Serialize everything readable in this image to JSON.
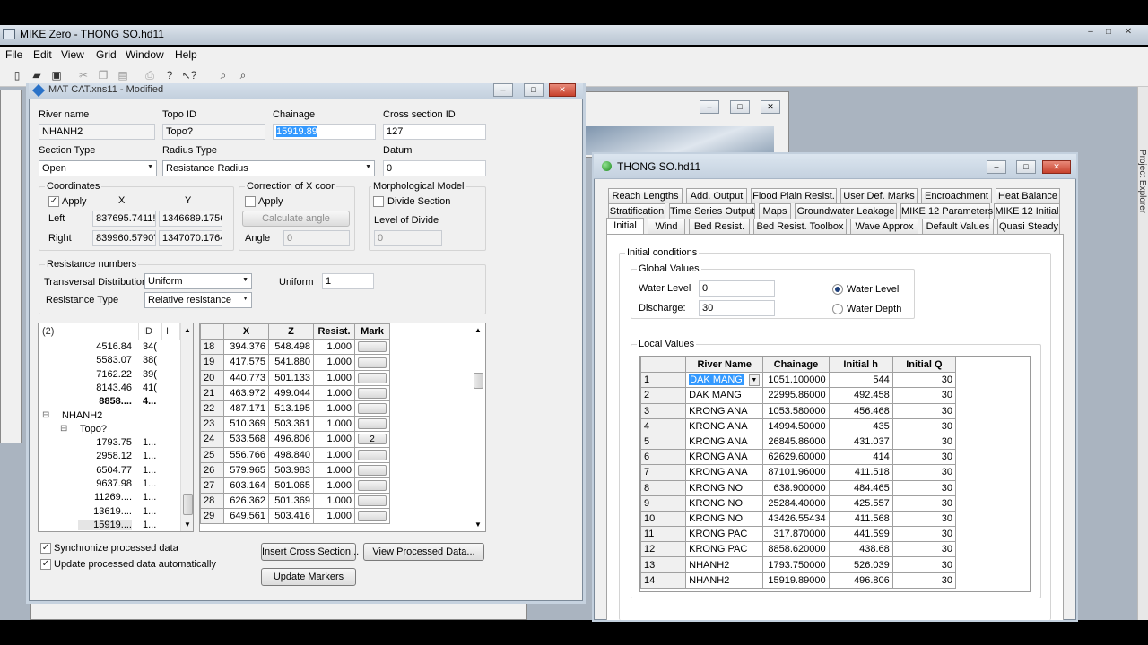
{
  "app": {
    "title": "MIKE Zero - THONG SO.hd11",
    "menu": [
      "File",
      "Edit",
      "View",
      "Grid",
      "Window",
      "Help"
    ]
  },
  "xs_window": {
    "title": "MAT CAT.xns11 - Modified",
    "river_name_label": "River name",
    "river_name": "NHANH2",
    "topo_id_label": "Topo ID",
    "topo_id": "Topo?",
    "chainage_label": "Chainage",
    "chainage": "15919.89",
    "cross_section_id_label": "Cross section ID",
    "cross_section_id": "127",
    "section_type_label": "Section Type",
    "section_type": "Open",
    "radius_type_label": "Radius Type",
    "radius_type": "Resistance Radius",
    "datum_label": "Datum",
    "datum": "0",
    "coordinates": {
      "group_label": "Coordinates",
      "apply_label": "Apply",
      "x_label": "X",
      "y_label": "Y",
      "left_label": "Left",
      "left_x": "837695.7411!",
      "left_y": "1346689.1756",
      "right_label": "Right",
      "right_x": "839960.5790'",
      "right_y": "1347070.1764"
    },
    "correction": {
      "group_label": "Correction of X coor",
      "apply_label": "Apply",
      "calc_button": "Calculate angle",
      "angle_label": "Angle",
      "angle": "0"
    },
    "morph": {
      "group_label": "Morphological Model",
      "divide_label": "Divide Section",
      "level_label": "Level of Divide",
      "level": "0"
    },
    "resistance": {
      "group_label": "Resistance numbers",
      "transversal_label": "Transversal Distribution",
      "transversal": "Uniform",
      "uniform_label": "Uniform",
      "uniform_value": "1",
      "type_label": "Resistance Type",
      "type": "Relative resistance"
    },
    "tree": {
      "header_name": "(2)",
      "header_id": "ID",
      "header_extra": "I",
      "rows": [
        {
          "name": "4516.84",
          "id": "34("
        },
        {
          "name": "5583.07",
          "id": "38("
        },
        {
          "name": "7162.22",
          "id": "39("
        },
        {
          "name": "8143.46",
          "id": "41("
        },
        {
          "name": "8858....",
          "id": "4..."
        },
        {
          "name": "NHANH2",
          "id": ""
        },
        {
          "name": "Topo?",
          "id": ""
        },
        {
          "name": "1793.75",
          "id": "1..."
        },
        {
          "name": "2958.12",
          "id": "1..."
        },
        {
          "name": "6504.77",
          "id": "1..."
        },
        {
          "name": "9637.98",
          "id": "1..."
        },
        {
          "name": "11269....",
          "id": "1..."
        },
        {
          "name": "13619....",
          "id": "1..."
        },
        {
          "name": "15919....",
          "id": "1..."
        }
      ]
    },
    "grid": {
      "headers": [
        "X",
        "Z",
        "Resist.",
        "Mark"
      ],
      "rows": [
        {
          "n": "18",
          "x": "394.376",
          "z": "548.498",
          "r": "1.000",
          "m": ""
        },
        {
          "n": "19",
          "x": "417.575",
          "z": "541.880",
          "r": "1.000",
          "m": ""
        },
        {
          "n": "20",
          "x": "440.773",
          "z": "501.133",
          "r": "1.000",
          "m": ""
        },
        {
          "n": "21",
          "x": "463.972",
          "z": "499.044",
          "r": "1.000",
          "m": ""
        },
        {
          "n": "22",
          "x": "487.171",
          "z": "513.195",
          "r": "1.000",
          "m": ""
        },
        {
          "n": "23",
          "x": "510.369",
          "z": "503.361",
          "r": "1.000",
          "m": ""
        },
        {
          "n": "24",
          "x": "533.568",
          "z": "496.806",
          "r": "1.000",
          "m": "2"
        },
        {
          "n": "25",
          "x": "556.766",
          "z": "498.840",
          "r": "1.000",
          "m": ""
        },
        {
          "n": "26",
          "x": "579.965",
          "z": "503.983",
          "r": "1.000",
          "m": ""
        },
        {
          "n": "27",
          "x": "603.164",
          "z": "501.065",
          "r": "1.000",
          "m": ""
        },
        {
          "n": "28",
          "x": "626.362",
          "z": "501.369",
          "r": "1.000",
          "m": ""
        },
        {
          "n": "29",
          "x": "649.561",
          "z": "503.416",
          "r": "1.000",
          "m": ""
        }
      ]
    },
    "sync_label": "Synchronize processed data",
    "update_label": "Update processed data automatically",
    "insert_button": "Insert Cross Section...",
    "view_button": "View Processed Data...",
    "update_markers_button": "Update Markers"
  },
  "hd_window": {
    "title": "THONG SO.hd11",
    "tabs_row1": [
      "Reach Lengths",
      "Add. Output",
      "Flood Plain Resist.",
      "User Def. Marks",
      "Encroachment",
      "Heat Balance"
    ],
    "tabs_row2": [
      "Stratification",
      "Time Series Output",
      "Maps",
      "Groundwater Leakage",
      "MIKE 12 Parameters",
      "MIKE 12 Initial"
    ],
    "tabs_row3": [
      "Initial",
      "Wind",
      "Bed Resist.",
      "Bed Resist. Toolbox",
      "Wave Approx",
      "Default Values",
      "Quasi Steady"
    ],
    "initial_conditions_label": "Initial conditions",
    "global_values_label": "Global Values",
    "water_level_label": "Water Level",
    "water_level": "0",
    "discharge_label": "Discharge:",
    "discharge": "30",
    "radio_water_level": "Water Level",
    "radio_water_depth": "Water Depth",
    "local_values_label": "Local Values",
    "local_headers": [
      "River Name",
      "Chainage",
      "Initial h",
      "Initial Q"
    ],
    "local_rows": [
      {
        "n": "1",
        "river": "DAK MANG",
        "ch": "1051.100000",
        "h": "544",
        "q": "30"
      },
      {
        "n": "2",
        "river": "DAK MANG",
        "ch": "22995.86000",
        "h": "492.458",
        "q": "30"
      },
      {
        "n": "3",
        "river": "KRONG ANA",
        "ch": "1053.580000",
        "h": "456.468",
        "q": "30"
      },
      {
        "n": "4",
        "river": "KRONG ANA",
        "ch": "14994.50000",
        "h": "435",
        "q": "30"
      },
      {
        "n": "5",
        "river": "KRONG ANA",
        "ch": "26845.86000",
        "h": "431.037",
        "q": "30"
      },
      {
        "n": "6",
        "river": "KRONG ANA",
        "ch": "62629.60000",
        "h": "414",
        "q": "30"
      },
      {
        "n": "7",
        "river": "KRONG ANA",
        "ch": "87101.96000",
        "h": "411.518",
        "q": "30"
      },
      {
        "n": "8",
        "river": "KRONG NO",
        "ch": "638.900000",
        "h": "484.465",
        "q": "30"
      },
      {
        "n": "9",
        "river": "KRONG NO",
        "ch": "25284.40000",
        "h": "425.557",
        "q": "30"
      },
      {
        "n": "10",
        "river": "KRONG NO",
        "ch": "43426.55434",
        "h": "411.568",
        "q": "30"
      },
      {
        "n": "11",
        "river": "KRONG PAC",
        "ch": "317.870000",
        "h": "441.599",
        "q": "30"
      },
      {
        "n": "12",
        "river": "KRONG PAC",
        "ch": "8858.620000",
        "h": "438.68",
        "q": "30"
      },
      {
        "n": "13",
        "river": "NHANH2",
        "ch": "1793.750000",
        "h": "526.039",
        "q": "30"
      },
      {
        "n": "14",
        "river": "NHANH2",
        "ch": "15919.89000",
        "h": "496.806",
        "q": "30"
      }
    ]
  },
  "sidebar": {
    "label": "Project Explorer"
  }
}
